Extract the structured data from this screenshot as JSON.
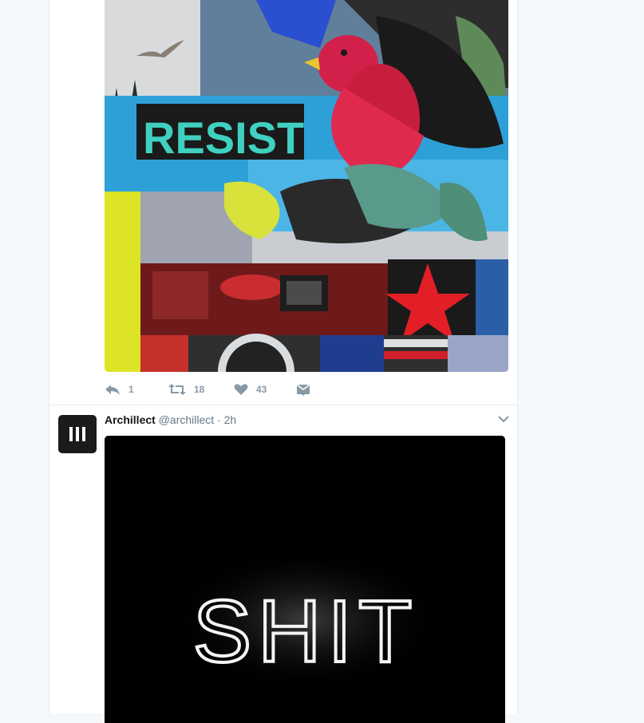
{
  "tweet_1": {
    "media": {
      "description_icon": "collage-artwork",
      "text": "RESIST"
    },
    "actions": {
      "reply_count": "1",
      "retweet_count": "18",
      "like_count": "43"
    }
  },
  "tweet_2": {
    "author": {
      "name": "Archillect",
      "handle": "@archillect",
      "separator": "·",
      "time": "2h",
      "avatar_text": "III"
    },
    "media": {
      "neon_text": "SHIT"
    }
  },
  "colors": {
    "background": "#f5f8fa",
    "card": "#ffffff",
    "action_gray": "#8899a6",
    "handle_gray": "#657786"
  }
}
